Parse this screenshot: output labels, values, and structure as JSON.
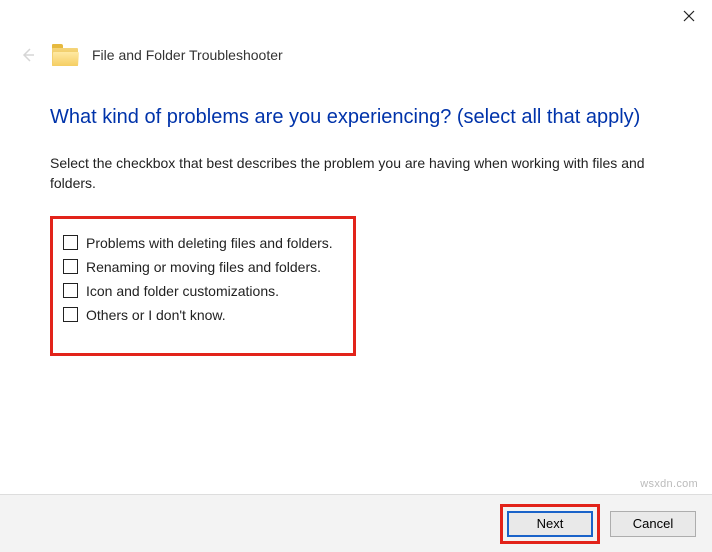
{
  "window": {
    "title": "File and Folder Troubleshooter"
  },
  "page": {
    "heading": "What kind of problems are you experiencing? (select all that apply)",
    "description": "Select the checkbox that best describes the problem you are having when working with files and folders."
  },
  "options": [
    "Problems with deleting files and folders.",
    "Renaming or moving files and folders.",
    "Icon and folder customizations.",
    "Others or I don't know."
  ],
  "buttons": {
    "next": "Next",
    "cancel": "Cancel"
  },
  "watermark": "wsxdn.com"
}
